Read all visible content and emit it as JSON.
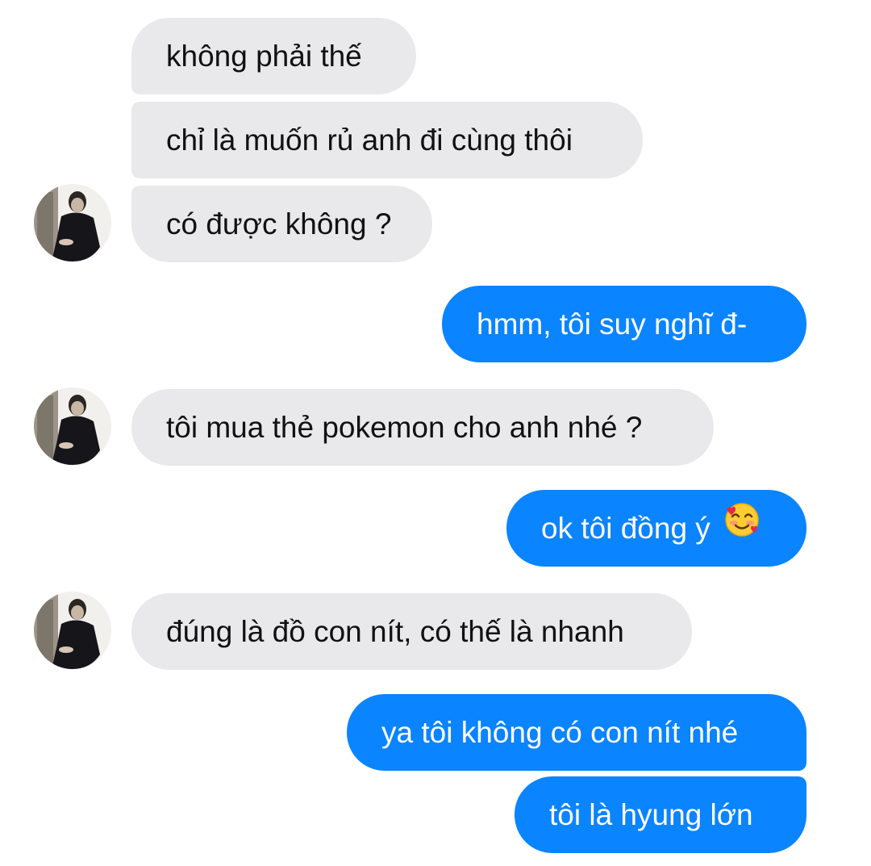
{
  "conversation": {
    "messages": [
      {
        "sender": "other",
        "text": "không phải thế"
      },
      {
        "sender": "other",
        "text": "chỉ là muốn rủ anh đi cùng thôi"
      },
      {
        "sender": "other",
        "text": "có được không ?"
      },
      {
        "sender": "me",
        "text": "hmm, tôi suy nghĩ đ-"
      },
      {
        "sender": "other",
        "text": "tôi mua thẻ pokemon cho anh nhé ?"
      },
      {
        "sender": "me",
        "text": "ok tôi đồng ý",
        "emoji": "smiling-face-with-hearts-icon"
      },
      {
        "sender": "other",
        "text": "đúng là đồ con nít, có thế là nhanh"
      },
      {
        "sender": "me",
        "text": "ya tôi không có con nít nhé"
      },
      {
        "sender": "me",
        "text": "tôi là hyung lớn"
      }
    ]
  },
  "colors": {
    "incoming_bubble": "#e9e9eb",
    "outgoing_bubble": "#0a84ff",
    "incoming_text": "#111111",
    "outgoing_text": "#ffffff",
    "background": "#ffffff"
  }
}
